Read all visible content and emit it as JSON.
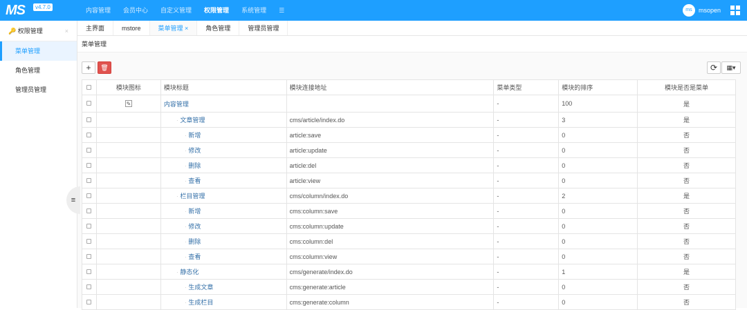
{
  "header": {
    "logo": "MS",
    "version": "v4.7.0",
    "nav": [
      "内容管理",
      "会员中心",
      "自定义管理",
      "权限管理",
      "系统管理"
    ],
    "active_nav": 3,
    "avatar": "ms",
    "user": "msopen"
  },
  "sidebar": {
    "title": "权限管理",
    "items": [
      "菜单管理",
      "角色管理",
      "管理员管理"
    ],
    "active": 0
  },
  "tabs": {
    "items": [
      "主界面",
      "mstore",
      "菜单管理 ×",
      "角色管理",
      "管理员管理"
    ],
    "active": 2
  },
  "breadcrumb": "菜单管理",
  "toolbar": {
    "add": "+",
    "delete": "🗑",
    "refresh": "⟳",
    "columns": "▦▾"
  },
  "table": {
    "headers": [
      "模块图标",
      "模块标题",
      "模块连接地址",
      "菜单类型",
      "模块的排序",
      "模块是否是菜单"
    ],
    "rows": [
      {
        "title": "内容管理",
        "level": 0,
        "url": "",
        "type": "-",
        "sort": "100",
        "menu": "是",
        "icon": true
      },
      {
        "title": "文章管理",
        "level": 1,
        "url": "cms/article/index.do",
        "type": "-",
        "sort": "3",
        "menu": "是"
      },
      {
        "title": "新增",
        "level": 2,
        "url": "article:save",
        "type": "-",
        "sort": "0",
        "menu": "否"
      },
      {
        "title": "修改",
        "level": 2,
        "url": "article:update",
        "type": "-",
        "sort": "0",
        "menu": "否"
      },
      {
        "title": "删除",
        "level": 2,
        "url": "article:del",
        "type": "-",
        "sort": "0",
        "menu": "否"
      },
      {
        "title": "查看",
        "level": 2,
        "url": "article:view",
        "type": "-",
        "sort": "0",
        "menu": "否"
      },
      {
        "title": "栏目管理",
        "level": 1,
        "url": "cms/column/index.do",
        "type": "-",
        "sort": "2",
        "menu": "是"
      },
      {
        "title": "新增",
        "level": 2,
        "url": "cms:column:save",
        "type": "-",
        "sort": "0",
        "menu": "否"
      },
      {
        "title": "修改",
        "level": 2,
        "url": "cms:column:update",
        "type": "-",
        "sort": "0",
        "menu": "否"
      },
      {
        "title": "删除",
        "level": 2,
        "url": "cms:column:del",
        "type": "-",
        "sort": "0",
        "menu": "否"
      },
      {
        "title": "查看",
        "level": 2,
        "url": "cms:column:view",
        "type": "-",
        "sort": "0",
        "menu": "否"
      },
      {
        "title": "静态化",
        "level": 1,
        "url": "cms/generate/index.do",
        "type": "-",
        "sort": "1",
        "menu": "是"
      },
      {
        "title": "生成文章",
        "level": 2,
        "url": "cms:generate:article",
        "type": "-",
        "sort": "0",
        "menu": "否"
      },
      {
        "title": "生成栏目",
        "level": 2,
        "url": "cms:generate:column",
        "type": "-",
        "sort": "0",
        "menu": "否"
      }
    ]
  }
}
